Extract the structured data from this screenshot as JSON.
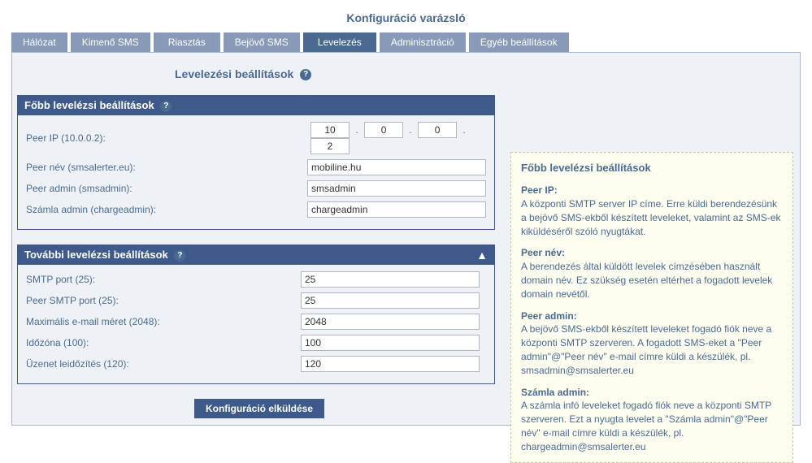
{
  "wizardTitle": "Konfiguráció varázsló",
  "tabs": [
    {
      "label": "Hálózat"
    },
    {
      "label": "Kimenő SMS"
    },
    {
      "label": "Riasztás"
    },
    {
      "label": "Bejövő SMS"
    },
    {
      "label": "Levelezés",
      "active": true
    },
    {
      "label": "Adminisztráció"
    },
    {
      "label": "Egyéb beállítások"
    }
  ],
  "pageTitle": "Levelezési beállítások",
  "section1": {
    "header": "Főbb levelézsi beállítások",
    "peerIpLabel": "Peer IP (10.0.0.2):",
    "peerIp": [
      "10",
      "0",
      "0",
      "2"
    ],
    "peerNameLabel": "Peer név (smsalerter.eu):",
    "peerName": "mobiline.hu",
    "peerAdminLabel": "Peer admin (smsadmin):",
    "peerAdmin": "smsadmin",
    "chargeAdminLabel": "Számla admin (chargeadmin):",
    "chargeAdmin": "chargeadmin"
  },
  "section2": {
    "header": "További levelézsi beállítások",
    "smtpPortLabel": "SMTP port (25):",
    "smtpPort": "25",
    "peerSmtpPortLabel": "Peer SMTP port (25):",
    "peerSmtpPort": "25",
    "maxEmailLabel": "Maximális e-mail méret (2048):",
    "maxEmail": "2048",
    "tzLabel": "Időzóna (100):",
    "tz": "100",
    "msgTimingLabel": "Üzenet leidőzítés (120):",
    "msgTiming": "120"
  },
  "submitLabel": "Konfiguráció elküldése",
  "help": {
    "title": "Főbb levelézsi beállítások",
    "t1": "Peer IP:",
    "d1": "A központi SMTP server IP címe. Erre küldi berendezésünk a bejövő SMS-ekből készített leveleket, valamint az SMS-ek kiküldéséről szóló nyugtákat.",
    "t2": "Peer név:",
    "d2": "A berendezés által küldött levelek címzésében használt domain név. Ez szükség esetén eltérhet a fogadott levelek domain nevétől.",
    "t3": "Peer admin:",
    "d3": "A bejövő SMS-ekből készített leveleket fogadó fiók neve a központi SMTP szerveren. A fogadott SMS-eket a \"Peer admin\"@\"Peer név\" e-mail címre küldi a készülék, pl. smsadmin@smsalerter.eu",
    "t4": "Számla admin:",
    "d4": "A számla infó leveleket fogadó fiók neve a központi SMTP szerveren. Ezt a nyugta levelet a \"Számla admin\"@\"Peer név\" e-mail címre küldi a készülék, pl. chargeadmin@smsalerter.eu"
  }
}
